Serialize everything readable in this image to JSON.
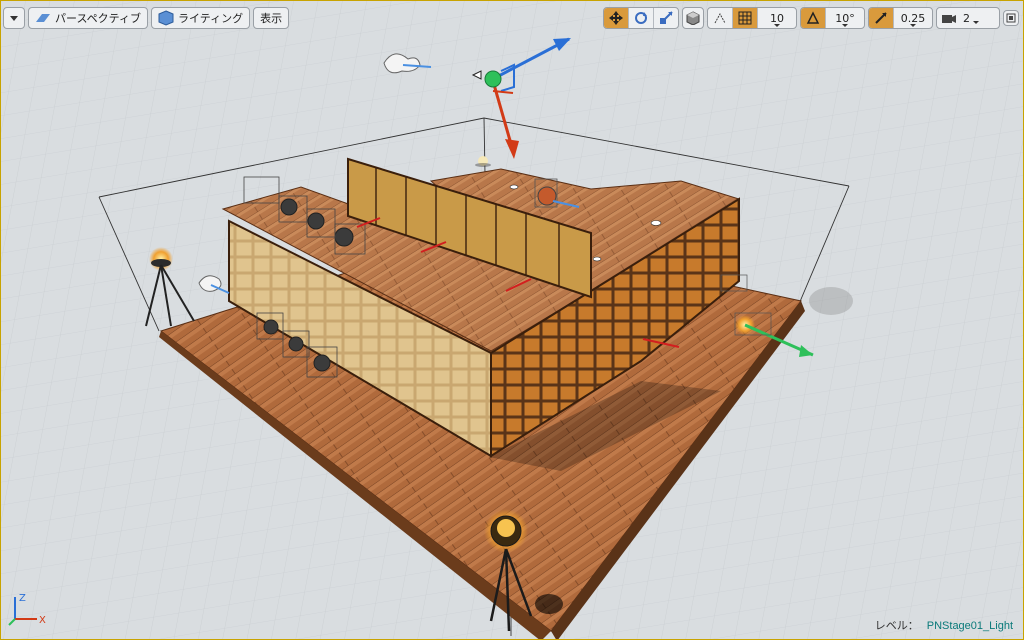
{
  "toolbar_left": {
    "view_mode_label": "パースペクティブ",
    "lit_mode_label": "ライティング",
    "show_label": "表示"
  },
  "toolbar_right": {
    "grid_snap_value": "10",
    "rotation_snap_value": "10°",
    "scale_snap_value": "0.25",
    "camera_speed_value": "2"
  },
  "status": {
    "level_label": "レベル：",
    "level_name": "PNStage01_Light"
  },
  "axis_gizmo": {
    "z": "Z",
    "x": "X"
  },
  "colors": {
    "accent_active": "#d99a3c",
    "viewport_border": "#c8a300",
    "gizmo_x": "#d23a16",
    "gizmo_y": "#2ec05a",
    "gizmo_z": "#2a6fd6"
  }
}
